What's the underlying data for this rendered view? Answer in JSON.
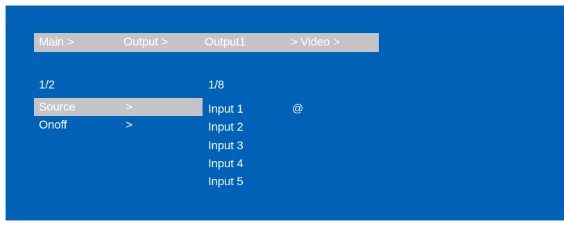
{
  "breadcrumb": {
    "items": [
      "Main  >",
      "Output >",
      "Output1",
      "> Video >"
    ]
  },
  "left_menu": {
    "page": "1/2",
    "items": [
      {
        "label": "Source",
        "arrow": ">",
        "selected": true
      },
      {
        "label": "Onoff",
        "arrow": ">",
        "selected": false
      }
    ]
  },
  "right_list": {
    "page": "1/8",
    "items": [
      "Input 1",
      "Input 2",
      "Input 3",
      "Input 4",
      "Input 5"
    ],
    "active_marker": "@"
  },
  "colors": {
    "background": "#0062b6",
    "highlight": "#c4c4c4",
    "text": "#ffffff"
  }
}
